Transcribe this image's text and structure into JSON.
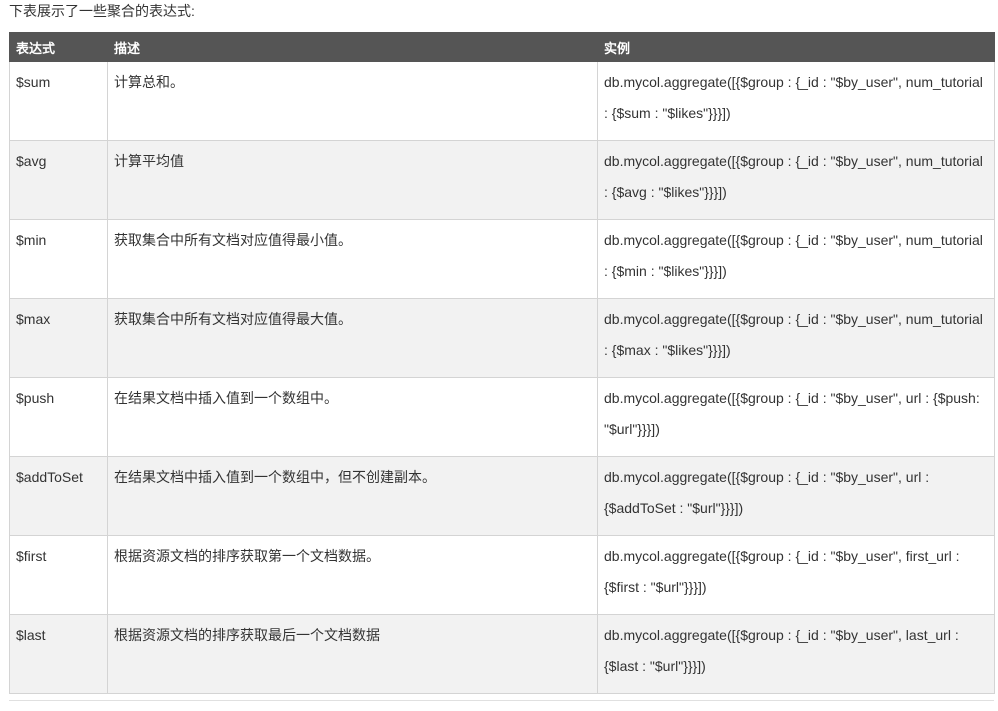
{
  "intro_text": "下表展示了一些聚合的表达式:",
  "table": {
    "headers": [
      "表达式",
      "描述",
      "实例"
    ],
    "rows": [
      {
        "expression": "$sum",
        "description": "计算总和。",
        "example": "db.mycol.aggregate([{$group : {_id : \"$by_user\", num_tutorial : {$sum : \"$likes\"}}}])"
      },
      {
        "expression": "$avg",
        "description": "计算平均值",
        "example": "db.mycol.aggregate([{$group : {_id : \"$by_user\", num_tutorial : {$avg : \"$likes\"}}}])"
      },
      {
        "expression": "$min",
        "description": "获取集合中所有文档对应值得最小值。",
        "example": "db.mycol.aggregate([{$group : {_id : \"$by_user\", num_tutorial : {$min : \"$likes\"}}}])"
      },
      {
        "expression": "$max",
        "description": "获取集合中所有文档对应值得最大值。",
        "example": "db.mycol.aggregate([{$group : {_id : \"$by_user\", num_tutorial : {$max : \"$likes\"}}}])"
      },
      {
        "expression": "$push",
        "description": "在结果文档中插入值到一个数组中。",
        "example": "db.mycol.aggregate([{$group : {_id : \"$by_user\", url : {$push: \"$url\"}}}])"
      },
      {
        "expression": "$addToSet",
        "description": "在结果文档中插入值到一个数组中，但不创建副本。",
        "example": "db.mycol.aggregate([{$group : {_id : \"$by_user\", url : {$addToSet : \"$url\"}}}])"
      },
      {
        "expression": "$first",
        "description": "根据资源文档的排序获取第一个文档数据。",
        "example": "db.mycol.aggregate([{$group : {_id : \"$by_user\", first_url : {$first : \"$url\"}}}])"
      },
      {
        "expression": "$last",
        "description": "根据资源文档的排序获取最后一个文档数据",
        "example": "db.mycol.aggregate([{$group : {_id : \"$by_user\", last_url : {$last : \"$url\"}}}])"
      }
    ]
  }
}
